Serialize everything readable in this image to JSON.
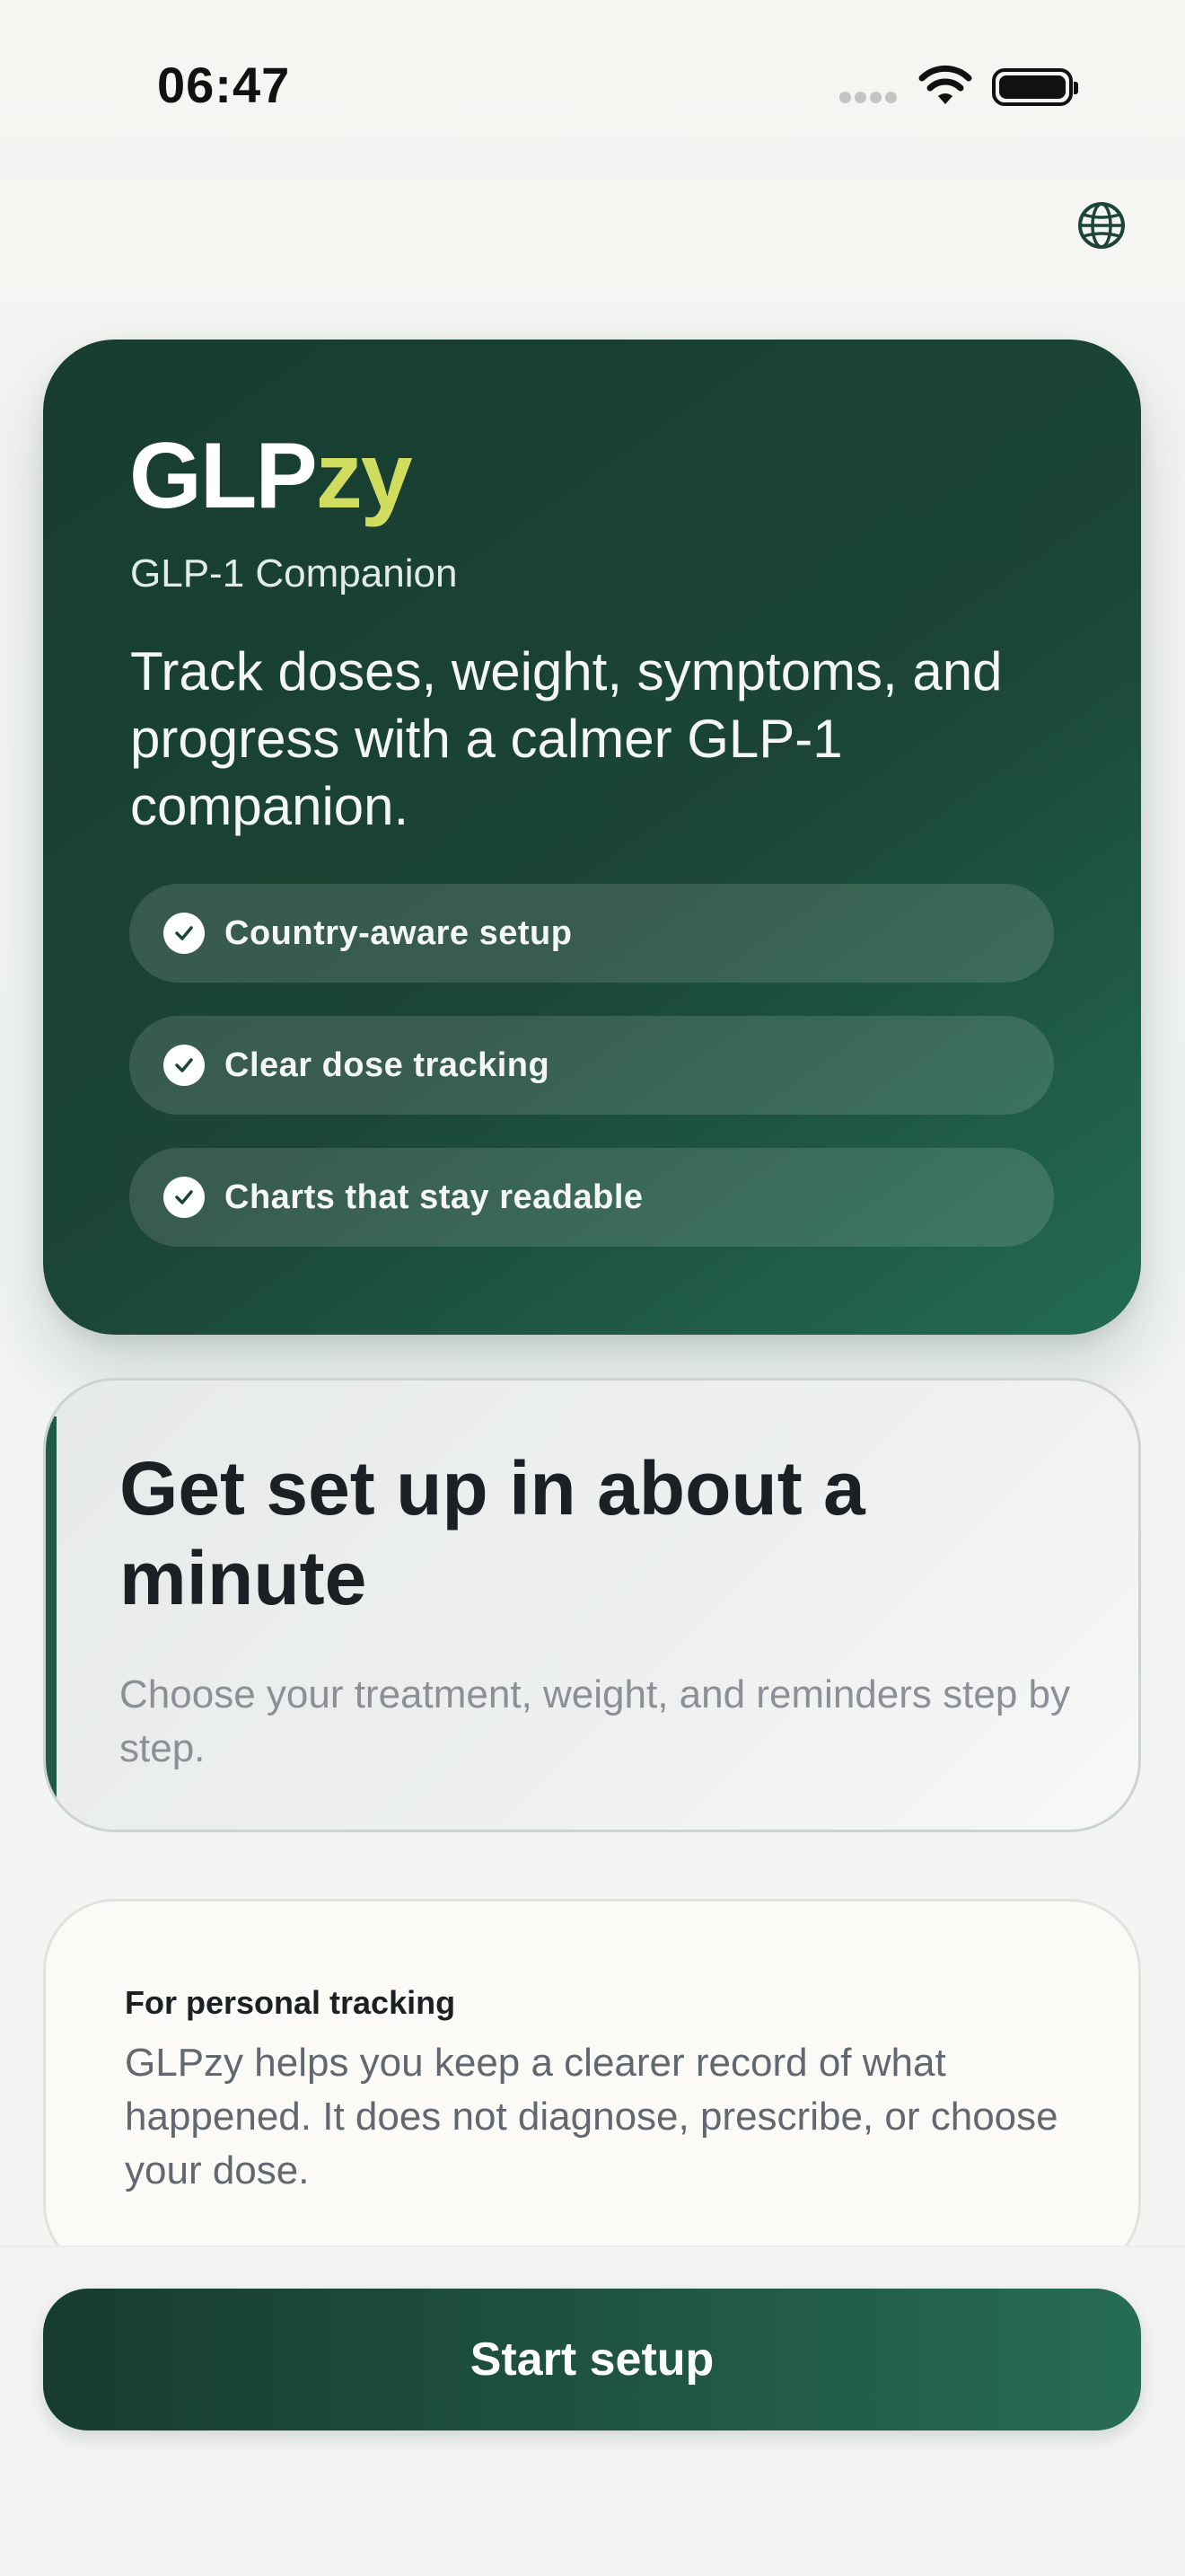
{
  "status_bar": {
    "time": "06:47"
  },
  "header": {
    "language_icon": "globe-icon"
  },
  "hero": {
    "brand_main": "GLP",
    "brand_accent": "zy",
    "subtitle": "GLP-1 Companion",
    "tagline": "Track doses, weight, symptoms, and progress with a calmer GLP-1 companion.",
    "features": [
      {
        "label": "Country-aware setup",
        "icon": "check-circle-icon"
      },
      {
        "label": "Clear dose tracking",
        "icon": "check-circle-icon"
      },
      {
        "label": "Charts that stay readable",
        "icon": "check-circle-icon"
      }
    ]
  },
  "setup": {
    "title": "Get set up in about a minute",
    "description": "Choose your treatment, weight, and reminders step by step."
  },
  "disclaimer": {
    "title": "For personal tracking",
    "text": "GLPzy helps you keep a clearer record of what happened. It does not diagnose, prescribe, or choose your dose."
  },
  "actions": {
    "start_label": "Start setup"
  },
  "colors": {
    "brand_green": "#1b4536",
    "accent_yellow": "#d0dc5d"
  }
}
